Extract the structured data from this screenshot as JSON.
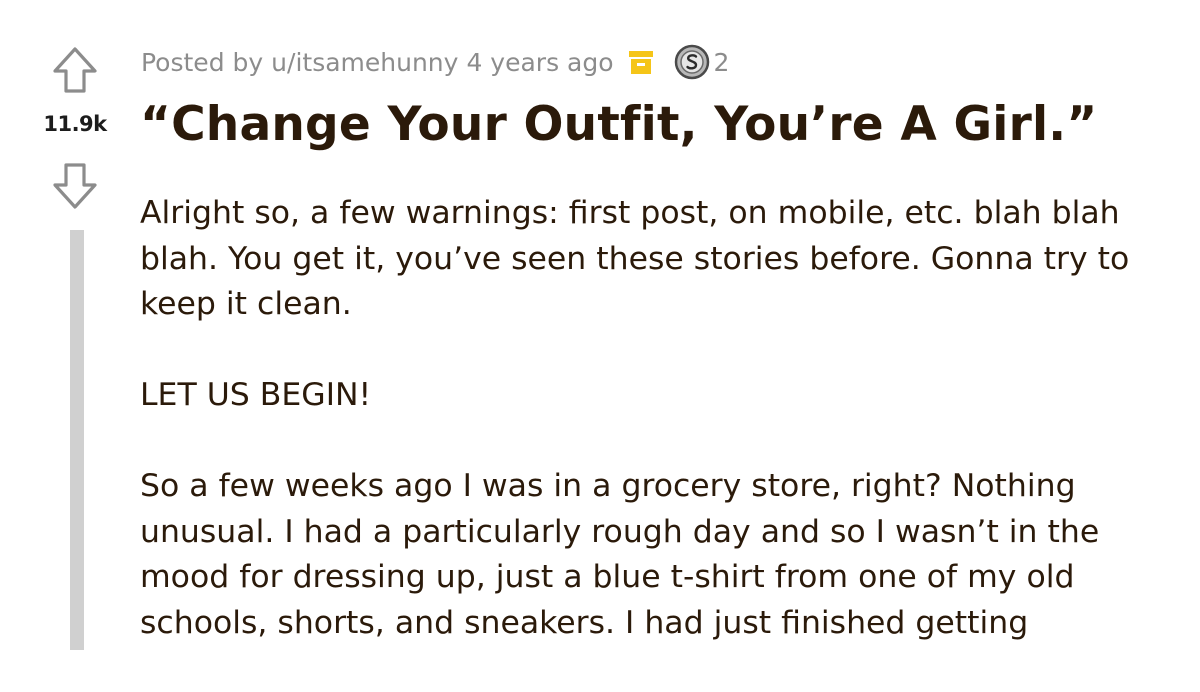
{
  "post": {
    "posted_by_label": "Posted by",
    "author": "u/itsamehunny",
    "time_ago": "4 years ago",
    "award_count": "2",
    "score": "11.9k",
    "title": "“Change Your Outfit, You’re A Girl.”",
    "body": [
      "Alright so, a few warnings: first post, on mobile, etc. blah blah blah. You get it, you’ve seen these stories before. Gonna try to keep it clean.",
      "LET US BEGIN!",
      "So a few weeks ago I was in a grocery store, right? Nothing unusual. I had a particularly rough day and so I wasn’t in the mood for dressing up, just a blue t-shirt from one of my old schools, shorts, and sneakers. I had just finished getting"
    ]
  },
  "icons": {
    "upvote": "upvote-arrow-icon",
    "downvote": "downvote-arrow-icon",
    "archive": "archive-box-icon",
    "award": "silver-award-icon"
  },
  "colors": {
    "text": "#2b1a0a",
    "meta": "#8c8c8c",
    "thread_line": "#d0d0d0",
    "archive": "#f5c518",
    "award": "#b0b0b0"
  }
}
